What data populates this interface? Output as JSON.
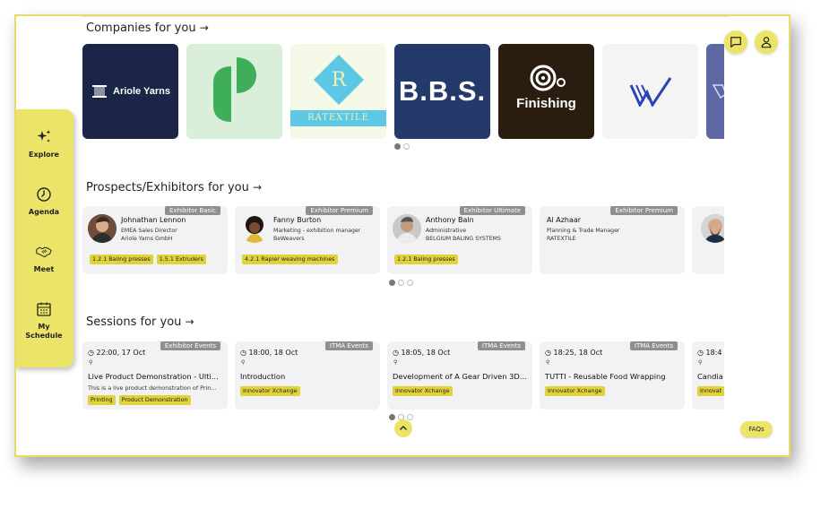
{
  "nav": {
    "explore": "Explore",
    "agenda": "Agenda",
    "meet": "Meet",
    "schedule_1": "My",
    "schedule_2": "Schedule"
  },
  "companies": {
    "title": "Companies for you",
    "arrow": "→",
    "logos": [
      {
        "name": "Ariole Yarns",
        "bg": "#1b2547"
      },
      {
        "name": "",
        "bg": "#d9efd9"
      },
      {
        "name": "RATEXTILE",
        "bg": "#f3f9e6"
      },
      {
        "name": "B.B.S.",
        "bg": "#243a6b"
      },
      {
        "name": "Finishing",
        "bg": "#2a1d10"
      },
      {
        "name": "",
        "bg": "#f4f4f4"
      },
      {
        "name": "",
        "bg": "#5d67a3"
      }
    ]
  },
  "prospects": {
    "title": "Prospects/Exhibitors for you",
    "arrow": "→",
    "cards": [
      {
        "tier": "Exhibitor Basic",
        "name": "Johnathan Lennon",
        "role": "EMEA Sales Director",
        "company": "Ariole Yarns GmbH",
        "tags": [
          "1.2.1 Baling presses",
          "1.5.1 Extruders"
        ]
      },
      {
        "tier": "Exhibitor Premium",
        "name": "Fanny Burton",
        "role": "Marketing - exhibition manager",
        "company": "BeWeavers",
        "tags": [
          "4.2.1 Rapier weaving machines"
        ]
      },
      {
        "tier": "Exhibitor Ultimate",
        "name": "Anthony Baln",
        "role": "Administrative",
        "company": "BELGIUM BALING SYSTEMS",
        "tags": [
          "1.2.1 Baling presses"
        ]
      },
      {
        "tier": "Exhibitor Premium",
        "name": "Al Azhaar",
        "role": "Planning & Trade Manager",
        "company": "RATEXTILE",
        "tags": []
      }
    ]
  },
  "sessions": {
    "title": "Sessions for you",
    "arrow": "→",
    "cards": [
      {
        "tier": "Exhibitor Events",
        "time": "22:00, 17 Oct",
        "title": "Live Product Demonstration - Ulti...",
        "desc": "This is a live product demonstration of Prin...",
        "tags": [
          "Printing",
          "Product Demonstration"
        ]
      },
      {
        "tier": "ITMA Events",
        "time": "18:00, 18 Oct",
        "title": "Introduction",
        "desc": "",
        "tags": [
          "Innovator Xchange"
        ]
      },
      {
        "tier": "ITMA Events",
        "time": "18:05, 18 Oct",
        "title": "Development of A Gear Driven 3D ...",
        "desc": "",
        "tags": [
          "Innovator Xchange"
        ]
      },
      {
        "tier": "ITMA Events",
        "time": "18:25, 18 Oct",
        "title": "TUTTI - Reusable Food Wrapping",
        "desc": "",
        "tags": [
          "Innovator Xchange"
        ]
      },
      {
        "tier": "",
        "time": "18:4",
        "title": "Candia",
        "desc": "",
        "tags": [
          "Innovat"
        ]
      }
    ]
  },
  "faq": "FAQs",
  "colors": {
    "accent": "#ece468",
    "tag": "#e0d33a",
    "card": "#f2f2f4"
  }
}
